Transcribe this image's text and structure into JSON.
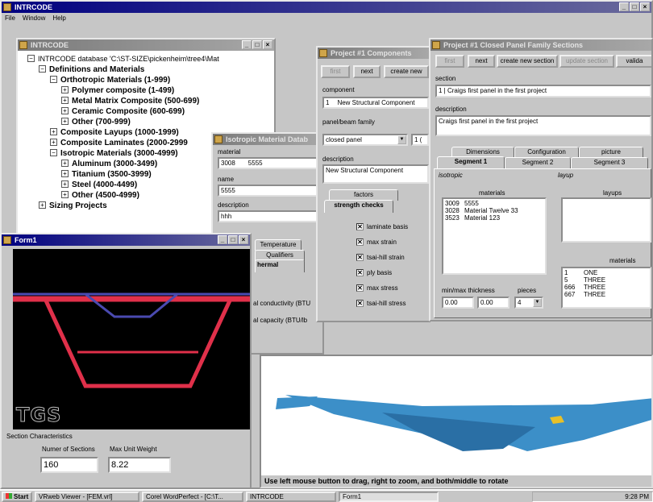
{
  "app": {
    "title": "INTRCODE",
    "menu": [
      "File",
      "Window",
      "Help"
    ]
  },
  "db_window": {
    "title": "INTRCODE",
    "tree": [
      {
        "sign": "−",
        "label": "INTRCODE database 'C:\\ST-SIZE\\pickenheim\\tree4\\Mat"
      },
      {
        "sign": "−",
        "label": "Definitions and Materials"
      },
      {
        "sign": "−",
        "label": "Orthotropic Materials (1-999)"
      },
      {
        "sign": "+",
        "label": "Polymer composite (1-499)"
      },
      {
        "sign": "+",
        "label": "Metal Matrix Composite (500-699)"
      },
      {
        "sign": "+",
        "label": "Ceramic Composite (600-699)"
      },
      {
        "sign": "+",
        "label": "Other (700-999)"
      },
      {
        "sign": "+",
        "label": "Composite Layups (1000-1999)"
      },
      {
        "sign": "+",
        "label": "Composite Laminates (2000-2999"
      },
      {
        "sign": "−",
        "label": "Isotropic Materials (3000-4999)"
      },
      {
        "sign": "+",
        "label": "Aluminum (3000-3499)"
      },
      {
        "sign": "+",
        "label": "Titanium (3500-3999)"
      },
      {
        "sign": "+",
        "label": "Steel (4000-4499)"
      },
      {
        "sign": "+",
        "label": "Other (4500-4999)"
      },
      {
        "sign": "+",
        "label": "Sizing Projects"
      }
    ]
  },
  "iso_window": {
    "title": "Isotropic Material Datab",
    "material_label": "material",
    "material_id": "3008",
    "material_code": "5555",
    "name_label": "name",
    "name_value": "5555",
    "description_label": "description",
    "description_value": "hhh",
    "tabs": [
      "Temperature",
      "Qualifiers",
      "hermal"
    ],
    "conductivity_label": "al conductivity (BTU",
    "capacity_label": "al capacity (BTU/lb"
  },
  "components_window": {
    "title": "Project #1 Components",
    "buttons": [
      "first",
      "next",
      "create new"
    ],
    "component_label": "component",
    "component_id": "1",
    "component_name": "New Structural Component",
    "family_label": "panel/beam family",
    "family_value": "closed panel",
    "family_extra": "1 (",
    "description_label": "description",
    "description_value": "New Structural Component",
    "tabs": [
      "factors",
      "strength checks"
    ],
    "checks": [
      "laminate basis",
      "max strain",
      "tsai-hill strain",
      "ply basis",
      "max stress",
      "tsai-hill stress"
    ]
  },
  "sections_window": {
    "title": "Project #1 Closed Panel Family Sections",
    "buttons": [
      "first",
      "next",
      "create new section",
      "update section",
      "valida"
    ],
    "section_label": "section",
    "section_value": "1 | Craigs first panel in the first project",
    "description_label": "description",
    "description_value": "Craigs first panel in the first project",
    "tabs_top": [
      "Dimensions",
      "Configuration",
      "picture"
    ],
    "tabs_bottom": [
      "Segment 1",
      "Segment 2",
      "Segment 3"
    ],
    "isotropic_group": "isotropic",
    "materials_header": "materials",
    "materials": [
      {
        "id": "3009",
        "name": "5555"
      },
      {
        "id": "3028",
        "name": "Material Twelve 33"
      },
      {
        "id": "3523",
        "name": "Material 123"
      }
    ],
    "layups_group": "layup",
    "layups_header": "layups",
    "layup_materials_header": "materials",
    "layup_materials": [
      {
        "id": "1",
        "name": "ONE"
      },
      {
        "id": "5",
        "name": "THREE"
      },
      {
        "id": "666",
        "name": "THREE"
      },
      {
        "id": "667",
        "name": "THREE"
      }
    ],
    "thickness_label": "min/max thickness",
    "min_thickness": "0.00",
    "max_thickness": "0.00",
    "pieces_label": "pieces",
    "pieces_value": "4"
  },
  "form1": {
    "title": "Form1",
    "logo": "TGS",
    "characteristics_label": "Section Characteristics",
    "num_sections_label": "Numer of Sections",
    "num_sections_value": "160",
    "max_weight_label": "Max Unit Weight",
    "max_weight_value": "8.22"
  },
  "viewer": {
    "status": "Use left mouse button to drag, right to zoom, and both/middle to rotate"
  },
  "taskbar": {
    "start": "Start",
    "items": [
      "VRweb Viewer - [FEM.vrl]",
      "Corel WordPerfect - [C:\\T...",
      "INTRCODE",
      "Form1"
    ],
    "clock": "9:28 PM"
  },
  "colors": {
    "titlebar": "#000080",
    "viewer_bg": "#ffffff",
    "model_blue": "#3c8fc8",
    "section_red": "#e0304a",
    "section_blue": "#4a4ab0"
  }
}
